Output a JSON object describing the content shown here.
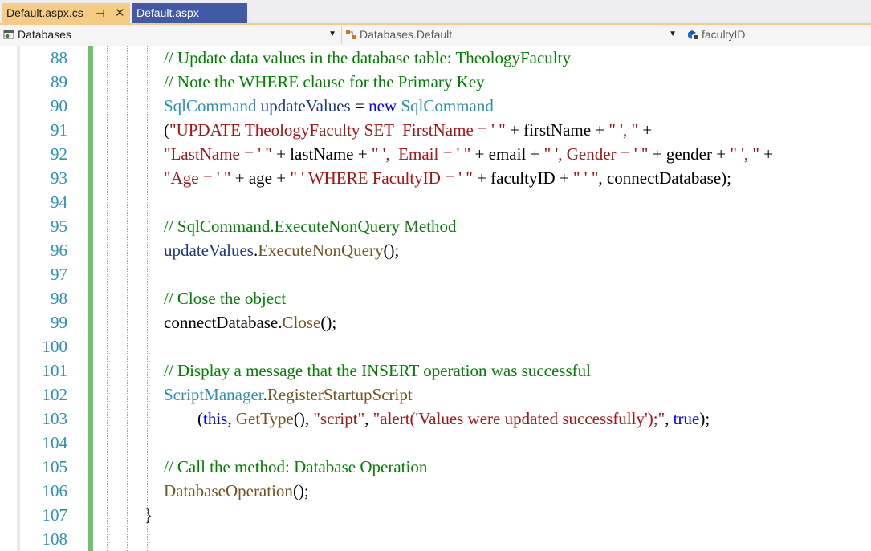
{
  "tabs": {
    "active": {
      "label": "Default.aspx.cs",
      "pin": "⊣",
      "close": "✕"
    },
    "inactive": {
      "label": "Default.aspx"
    }
  },
  "navbar": {
    "project": "Databases",
    "type": "Databases.Default",
    "member": "facultyID"
  },
  "editor": {
    "line_numbers": [
      "88",
      "89",
      "90",
      "91",
      "92",
      "93",
      "94",
      "95",
      "96",
      "97",
      "98",
      "99",
      "100",
      "101",
      "102",
      "103",
      "104",
      "105",
      "106",
      "107",
      "108"
    ],
    "lines": [
      {
        "indent": "",
        "tokens": [
          {
            "c": "cm",
            "t": "// Update data values in the database table: TheologyFaculty"
          }
        ]
      },
      {
        "indent": "",
        "tokens": [
          {
            "c": "cm",
            "t": "// Note the WHERE clause for the Primary Key"
          }
        ]
      },
      {
        "indent": "",
        "tokens": [
          {
            "c": "ty",
            "t": "SqlCommand"
          },
          {
            "c": "pl",
            "t": " "
          },
          {
            "c": "vr",
            "t": "updateValues"
          },
          {
            "c": "pl",
            "t": " = "
          },
          {
            "c": "kw",
            "t": "new"
          },
          {
            "c": "pl",
            "t": " "
          },
          {
            "c": "ty",
            "t": "SqlCommand"
          }
        ]
      },
      {
        "indent": "",
        "tokens": [
          {
            "c": "pl",
            "t": "("
          },
          {
            "c": "st",
            "t": "\"UPDATE TheologyFaculty SET  FirstName = ' \""
          },
          {
            "c": "pl",
            "t": " + firstName + "
          },
          {
            "c": "st",
            "t": "\" ', \""
          },
          {
            "c": "pl",
            "t": " +"
          }
        ]
      },
      {
        "indent": "",
        "tokens": [
          {
            "c": "st",
            "t": "\"LastName = ' \""
          },
          {
            "c": "pl",
            "t": " + lastName + "
          },
          {
            "c": "st",
            "t": "\" ',  Email = ' \""
          },
          {
            "c": "pl",
            "t": " + email + "
          },
          {
            "c": "st",
            "t": "\" ', Gender = ' \""
          },
          {
            "c": "pl",
            "t": " + gender + "
          },
          {
            "c": "st",
            "t": "\" ', \""
          },
          {
            "c": "pl",
            "t": " +"
          }
        ]
      },
      {
        "indent": "",
        "tokens": [
          {
            "c": "st",
            "t": "\"Age = ' \""
          },
          {
            "c": "pl",
            "t": " + age + "
          },
          {
            "c": "st",
            "t": "\" ' WHERE FacultyID = ' \""
          },
          {
            "c": "pl",
            "t": " + facultyID + "
          },
          {
            "c": "st",
            "t": "\" ' \""
          },
          {
            "c": "pl",
            "t": ", connectDatabase);"
          }
        ]
      },
      {
        "indent": "",
        "tokens": []
      },
      {
        "indent": "",
        "tokens": [
          {
            "c": "cm",
            "t": "// SqlCommand.ExecuteNonQuery Method"
          }
        ]
      },
      {
        "indent": "",
        "tokens": [
          {
            "c": "vr",
            "t": "updateValues"
          },
          {
            "c": "pl",
            "t": "."
          },
          {
            "c": "mt",
            "t": "ExecuteNonQuery"
          },
          {
            "c": "pl",
            "t": "();"
          }
        ]
      },
      {
        "indent": "",
        "tokens": []
      },
      {
        "indent": "",
        "tokens": [
          {
            "c": "cm",
            "t": "// Close the object"
          }
        ]
      },
      {
        "indent": "",
        "tokens": [
          {
            "c": "pl",
            "t": "connectDatabase."
          },
          {
            "c": "mt",
            "t": "Close"
          },
          {
            "c": "pl",
            "t": "();"
          }
        ]
      },
      {
        "indent": "",
        "tokens": []
      },
      {
        "indent": "",
        "tokens": [
          {
            "c": "cm",
            "t": "// Display a message that the INSERT operation was successful"
          }
        ]
      },
      {
        "indent": "",
        "tokens": [
          {
            "c": "ty",
            "t": "ScriptManager"
          },
          {
            "c": "pl",
            "t": "."
          },
          {
            "c": "mt",
            "t": "RegisterStartupScript"
          }
        ]
      },
      {
        "indent": "        ",
        "tokens": [
          {
            "c": "pl",
            "t": "("
          },
          {
            "c": "kw",
            "t": "this"
          },
          {
            "c": "pl",
            "t": ", "
          },
          {
            "c": "mt",
            "t": "GetType"
          },
          {
            "c": "pl",
            "t": "(), "
          },
          {
            "c": "st",
            "t": "\"script\""
          },
          {
            "c": "pl",
            "t": ", "
          },
          {
            "c": "st",
            "t": "\"alert('Values were updated successfully');\""
          },
          {
            "c": "pl",
            "t": ", "
          },
          {
            "c": "kw",
            "t": "true"
          },
          {
            "c": "pl",
            "t": ");"
          }
        ]
      },
      {
        "indent": "",
        "tokens": []
      },
      {
        "indent": "",
        "tokens": [
          {
            "c": "cm",
            "t": "// Call the method: Database Operation"
          }
        ]
      },
      {
        "indent": "",
        "tokens": [
          {
            "c": "mt",
            "t": "DatabaseOperation"
          },
          {
            "c": "pl",
            "t": "();"
          }
        ]
      },
      {
        "indent": "",
        "tokens": [
          {
            "c": "pl",
            "t": "}"
          }
        ]
      },
      {
        "indent": "",
        "tokens": []
      }
    ]
  },
  "colors": {
    "comment": "#008000",
    "type": "#2b91af",
    "keyword": "#0000ff",
    "string": "#a31515",
    "method": "#74531f",
    "variable": "#1f377f",
    "line_number": "#2b91af",
    "change_bar": "#6ec46a",
    "active_tab": "#f5cc84",
    "inactive_tab": "#425aa5"
  },
  "icons": {
    "pin": "pin-icon",
    "close": "close-icon",
    "project": "csharp-project-icon",
    "type": "class-icon",
    "member": "field-icon",
    "dropdown": "chevron-down-icon"
  }
}
